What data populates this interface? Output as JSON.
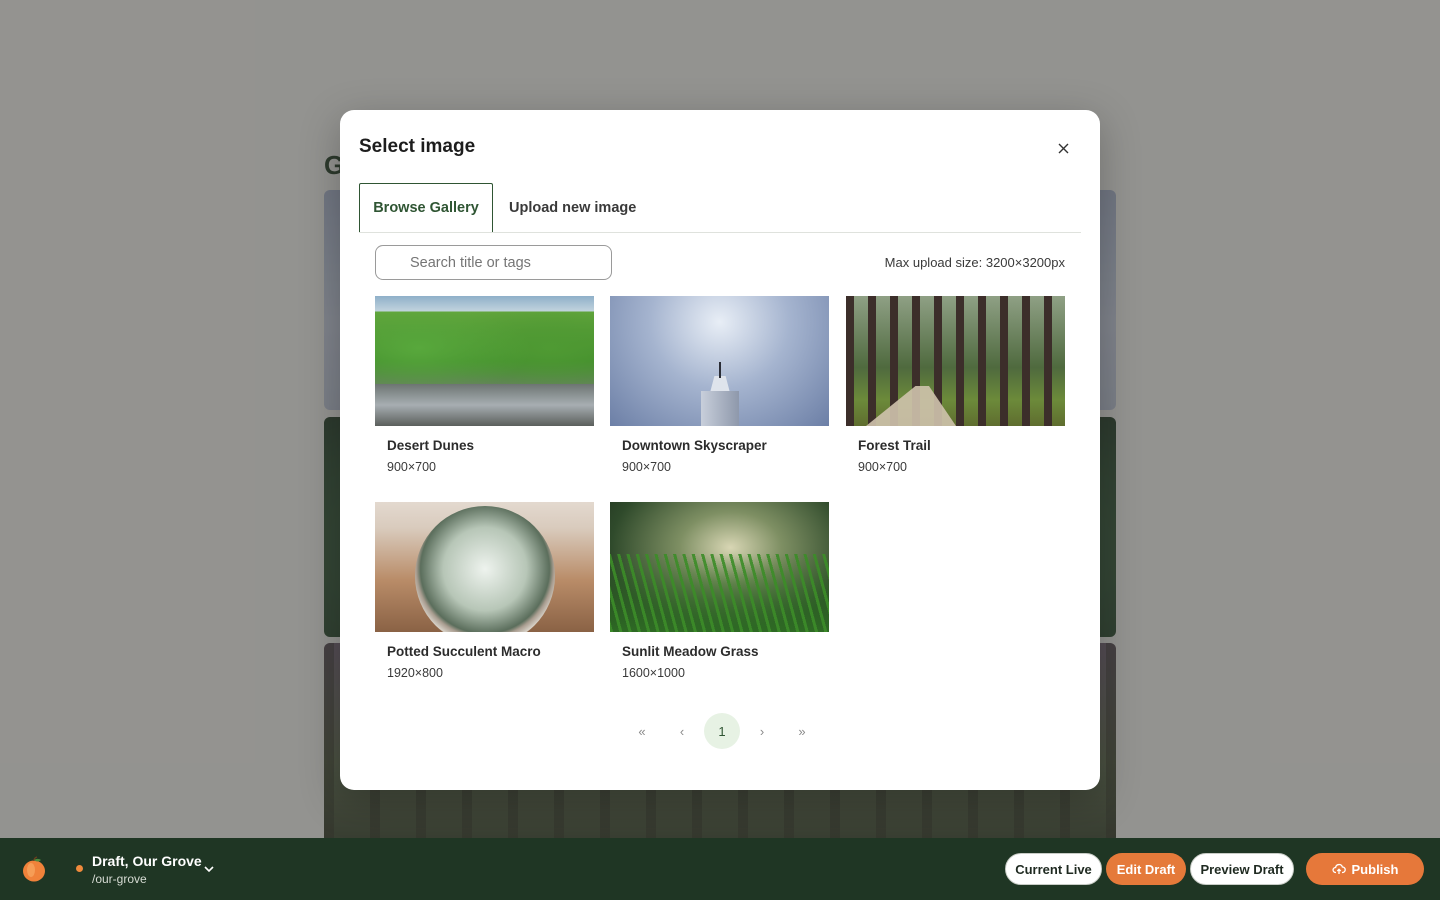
{
  "background": {
    "heading_fragment": "G"
  },
  "modal": {
    "title": "Select image",
    "tabs": [
      {
        "label": "Browse Gallery",
        "active": true
      },
      {
        "label": "Upload new image",
        "active": false
      }
    ],
    "search": {
      "placeholder": "Search title or tags",
      "value": ""
    },
    "max_upload_text": "Max upload size: 3200×3200px",
    "images": [
      {
        "title": "Desert Dunes",
        "size": "900×700"
      },
      {
        "title": "Downtown Skyscraper",
        "size": "900×700"
      },
      {
        "title": "Forest Trail",
        "size": "900×700"
      },
      {
        "title": "Potted Succulent Macro",
        "size": "1920×800"
      },
      {
        "title": "Sunlit Meadow Grass",
        "size": "1600×1000"
      }
    ],
    "pagination": {
      "first": "«",
      "prev": "‹",
      "current": "1",
      "next": "›",
      "last": "»"
    }
  },
  "bottombar": {
    "site_name": "Draft, Our Grove",
    "site_path": "/our-grove",
    "status_color": "#f08a3c",
    "buttons": {
      "current_live": "Current Live",
      "edit_draft": "Edit Draft",
      "preview_draft": "Preview Draft",
      "publish": "Publish"
    }
  },
  "colors": {
    "brand_green": "#1f3624",
    "accent_orange": "#e6783a",
    "active_tab": "#2f5533"
  }
}
